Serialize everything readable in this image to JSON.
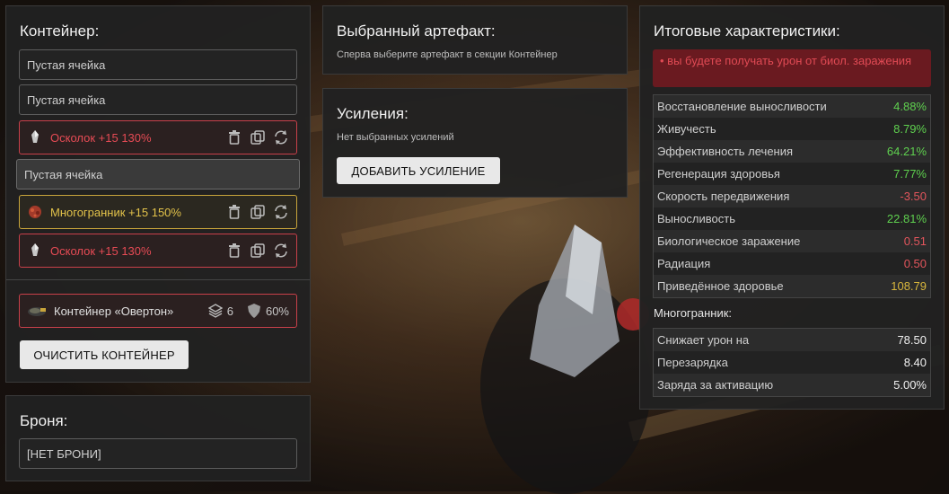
{
  "container_panel": {
    "title": "Контейнер:",
    "slots": [
      {
        "label": "Пустая ячейка",
        "state": "empty"
      },
      {
        "label": "Пустая ячейка",
        "state": "empty"
      },
      {
        "label": "Осколок +15 130%",
        "state": "red"
      },
      {
        "label": "Пустая ячейка",
        "state": "selected"
      },
      {
        "label": "Многогранник +15 150%",
        "state": "yellow"
      },
      {
        "label": "Осколок +15 130%",
        "state": "red"
      }
    ],
    "container": {
      "label": "Контейнер «Овертон»",
      "capacity": "6",
      "protection": "60%"
    },
    "clear_button": "ОЧИСТИТЬ КОНТЕЙНЕР"
  },
  "armor_panel": {
    "title": "Броня:",
    "value": "[НЕТ БРОНИ]"
  },
  "artifact_panel": {
    "title": "Выбранный артефакт:",
    "hint": "Сперва выберите артефакт в секции Контейнер"
  },
  "boost_panel": {
    "title": "Усиления:",
    "hint": "Нет выбранных усилений",
    "add_button": "ДОБАВИТЬ УСИЛЕНИЕ"
  },
  "stats_panel": {
    "title": "Итоговые характеристики:",
    "warning": "вы будете получать урон от биол. заражения",
    "stats": [
      {
        "label": "Восстановление выносливости",
        "value": "4.88%",
        "tone": "green"
      },
      {
        "label": "Живучесть",
        "value": "8.79%",
        "tone": "green"
      },
      {
        "label": "Эффективность лечения",
        "value": "64.21%",
        "tone": "green"
      },
      {
        "label": "Регенерация здоровья",
        "value": "7.77%",
        "tone": "green"
      },
      {
        "label": "Скорость передвижения",
        "value": "-3.50",
        "tone": "red"
      },
      {
        "label": "Выносливость",
        "value": "22.81%",
        "tone": "green"
      },
      {
        "label": "Биологическое заражение",
        "value": "0.51",
        "tone": "red"
      },
      {
        "label": "Радиация",
        "value": "0.50",
        "tone": "red"
      },
      {
        "label": "Приведённое здоровье",
        "value": "108.79",
        "tone": "yellow"
      }
    ],
    "sub_title": "Многогранник:",
    "sub_stats": [
      {
        "label": "Снижает урон на",
        "value": "78.50"
      },
      {
        "label": "Перезарядка",
        "value": "8.40"
      },
      {
        "label": "Заряда за активацию",
        "value": "5.00%"
      }
    ]
  },
  "colors": {
    "red": "#e2555c",
    "green": "#5fd04f",
    "yellow": "#d8b63c",
    "warning_bg": "#6a1a20"
  }
}
